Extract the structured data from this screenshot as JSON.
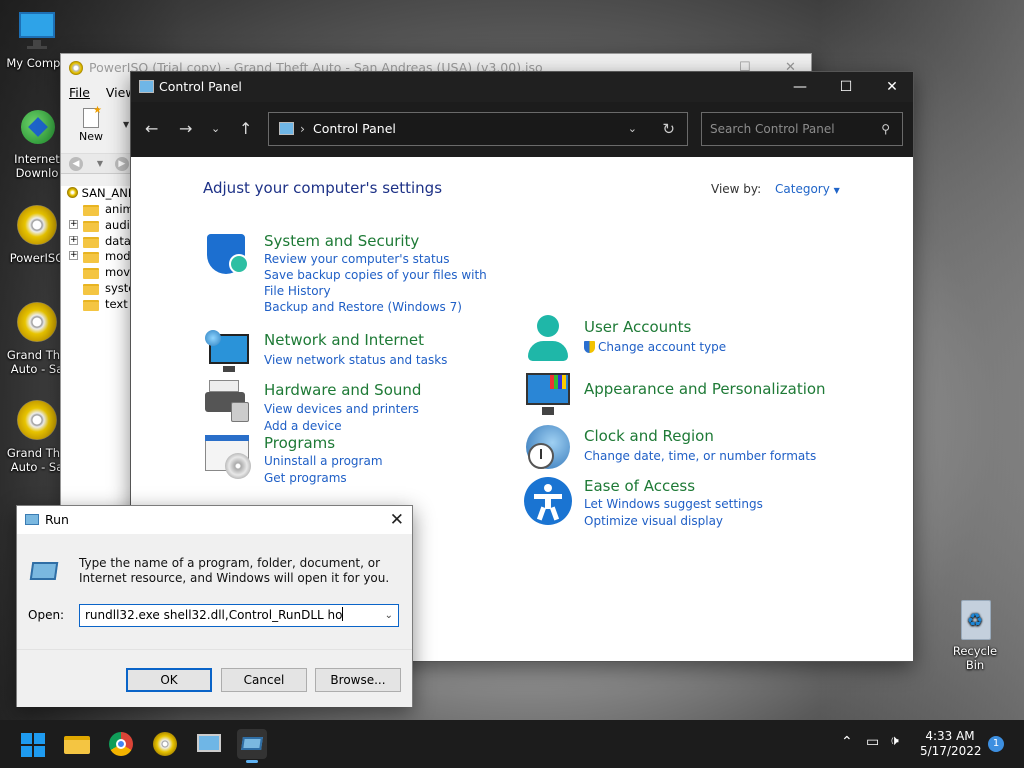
{
  "desktop": {
    "icons": [
      {
        "label": "My Compu",
        "name": "desktop-icon-my-computer"
      },
      {
        "label": "Internet Downlo",
        "name": "desktop-icon-internet-download"
      },
      {
        "label": "PowerISO",
        "name": "desktop-icon-poweriso"
      },
      {
        "label": "Grand The Auto - Sa",
        "name": "desktop-icon-gta-1"
      },
      {
        "label": "Grand The Auto - Sa",
        "name": "desktop-icon-gta-2"
      },
      {
        "label": "Recycle Bin",
        "name": "desktop-icon-recycle-bin"
      }
    ]
  },
  "poweriso": {
    "title": "PowerISO (Trial copy) - Grand Theft Auto - San Andreas (USA) (v3.00).iso",
    "menu": [
      "File",
      "View"
    ],
    "toolbar_new": "New",
    "tree_root": "SAN_AND",
    "tree": [
      "anim",
      "audio",
      "data",
      "mode",
      "movie",
      "syste",
      "text"
    ]
  },
  "control_panel": {
    "title": "Control Panel",
    "address": "Control Panel",
    "search_placeholder": "Search Control Panel",
    "heading": "Adjust your computer's settings",
    "view_by_label": "View by:",
    "view_by_value": "Category",
    "categories": {
      "system_security": {
        "title": "System and Security",
        "links": [
          "Review your computer's status",
          "Save backup copies of your files with File History",
          "Backup and Restore (Windows 7)"
        ]
      },
      "network": {
        "title": "Network and Internet",
        "links": [
          "View network status and tasks"
        ]
      },
      "hardware": {
        "title": "Hardware and Sound",
        "links": [
          "View devices and printers",
          "Add a device"
        ]
      },
      "programs": {
        "title": "Programs",
        "links": [
          "Uninstall a program",
          "Get programs"
        ]
      },
      "user_accounts": {
        "title": "User Accounts",
        "links": [
          "Change account type"
        ]
      },
      "appearance": {
        "title": "Appearance and Personalization"
      },
      "clock": {
        "title": "Clock and Region",
        "links": [
          "Change date, time, or number formats"
        ]
      },
      "ease": {
        "title": "Ease of Access",
        "links": [
          "Let Windows suggest settings",
          "Optimize visual display"
        ]
      }
    }
  },
  "run_dialog": {
    "title": "Run",
    "description": "Type the name of a program, folder, document, or Internet resource, and Windows will open it for you.",
    "open_label": "Open:",
    "input_value": "rundll32.exe shell32.dll,Control_RunDLL ho",
    "ok": "OK",
    "cancel": "Cancel",
    "browse": "Browse..."
  },
  "taskbar": {
    "time": "4:33 AM",
    "date": "5/17/2022",
    "notification_count": "1"
  }
}
